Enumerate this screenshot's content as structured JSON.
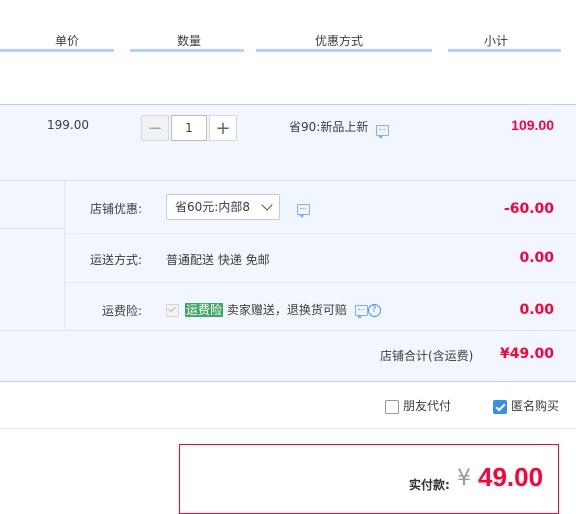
{
  "header": {
    "col_unit_price": "单价",
    "col_quantity": "数量",
    "col_discount": "优惠方式",
    "col_subtotal": "小计"
  },
  "item": {
    "price": "199.00",
    "quantity": "1",
    "minus_label": "−",
    "plus_label": "+",
    "discount_text": "省90:新品上新",
    "subtotal": "109.00"
  },
  "shop": {
    "discount_label": "店铺优惠:",
    "discount_select": "省60元:内部8",
    "discount_amount": "-60.00",
    "shipping_label": "运送方式:",
    "shipping_text": "普通配送 快递 免邮",
    "shipping_amount": "0.00",
    "insurance_label": "运费险:",
    "insurance_badge": "运费险",
    "insurance_text": "卖家赠送，退换货可赔",
    "insurance_amount": "0.00",
    "total_label": "店铺合计(含运费)",
    "total_amount": "¥49.00"
  },
  "options": {
    "friend_pay": "朋友代付",
    "anonymous": "匿名购买",
    "anonymous_checked": true,
    "friend_pay_checked": false
  },
  "payment": {
    "label": "实付款:",
    "currency": "¥",
    "amount": "49.00"
  },
  "colors": {
    "accent_red": "#ff0036",
    "header_line": "#b2d1ff",
    "row_bg": "#f2f7ff",
    "insurance_green": "#40a860"
  },
  "icons": [
    "chat-icon",
    "chevron-down-icon",
    "help-icon",
    "checkmark-icon"
  ]
}
